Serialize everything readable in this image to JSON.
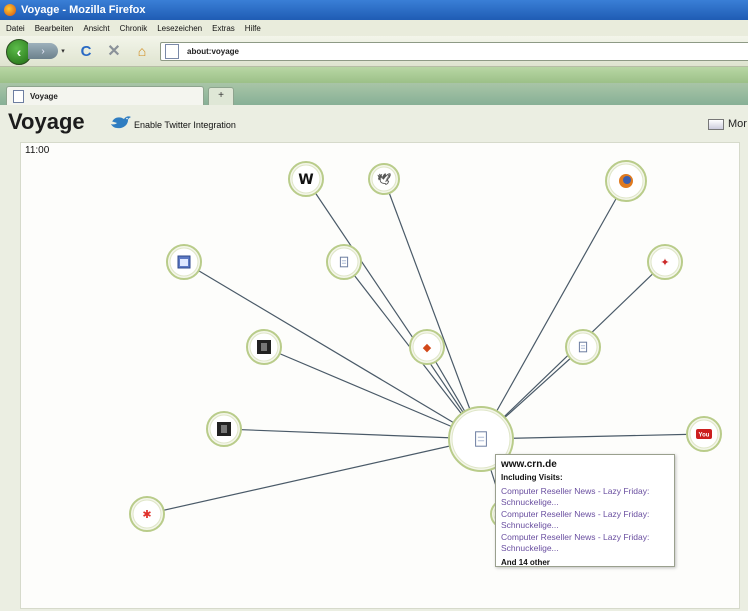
{
  "window": {
    "title": "Voyage - Mozilla Firefox"
  },
  "menu": {
    "items": [
      {
        "label": "Datei",
        "key": "D"
      },
      {
        "label": "Bearbeiten",
        "key": "B"
      },
      {
        "label": "Ansicht",
        "key": "A"
      },
      {
        "label": "Chronik",
        "key": "C"
      },
      {
        "label": "Lesezeichen",
        "key": "L"
      },
      {
        "label": "Extras",
        "key": "x"
      },
      {
        "label": "Hilfe",
        "key": "H"
      }
    ]
  },
  "toolbar": {
    "back_glyph": "‹",
    "forward_glyph": "›",
    "dropdown_glyph": "▾",
    "reload_glyph": "C",
    "stop_glyph": "✕",
    "home_glyph": "⌂"
  },
  "address": {
    "url": "about:voyage"
  },
  "tabs": {
    "active_label": "Voyage",
    "new_tab_glyph": "+"
  },
  "page": {
    "heading": "Voyage",
    "twitter_link": "Enable Twitter Integration",
    "more_label": "Mor",
    "time_label": "11:00"
  },
  "graph": {
    "center_icon": "document-icon",
    "nodes": [
      {
        "name": "wikipedia",
        "icon": "wikipedia-w-icon",
        "glyph": "W",
        "color": "#111111"
      },
      {
        "name": "bird-site",
        "icon": "bird-icon",
        "glyph": "🕊",
        "color": "#555555"
      },
      {
        "name": "firefox-site",
        "icon": "firefox-icon",
        "glyph": "◉",
        "color": "#d5651a"
      },
      {
        "name": "blue-site",
        "icon": "window-icon",
        "glyph": "▣",
        "color": "#4966b4"
      },
      {
        "name": "doc-top",
        "icon": "document-icon",
        "glyph": "",
        "color": "#6d7ea1"
      },
      {
        "name": "red-site-top-right",
        "icon": "red-logo-icon",
        "glyph": "✦",
        "color": "#cc2a2a"
      },
      {
        "name": "dark-site",
        "icon": "dark-square-icon",
        "glyph": "■",
        "color": "#222222"
      },
      {
        "name": "fox-site",
        "icon": "fox-icon",
        "glyph": "◆",
        "color": "#d2481a"
      },
      {
        "name": "doc-right",
        "icon": "document-icon",
        "glyph": "",
        "color": "#6d7ea1"
      },
      {
        "name": "dark-site-2",
        "icon": "dark-square-icon",
        "glyph": "◧",
        "color": "#222222"
      },
      {
        "name": "youtube",
        "icon": "youtube-icon",
        "glyph": "You",
        "color": "#cc1f1f"
      },
      {
        "name": "red-flower",
        "icon": "flower-icon",
        "glyph": "✱",
        "color": "#e0302a"
      },
      {
        "name": "hidden-under-tooltip",
        "icon": "document-icon",
        "glyph": "",
        "color": "#6d7ea1"
      }
    ]
  },
  "tooltip": {
    "domain": "www.crn.de",
    "subhead": "Including Visits:",
    "visits": [
      "Computer Reseller News - Lazy Friday: Schnuckelige...",
      "Computer Reseller News - Lazy Friday: Schnuckelige...",
      "Computer Reseller News - Lazy Friday: Schnuckelige..."
    ],
    "more": "And 14 other"
  },
  "colors": {
    "edge": "#4a5a68",
    "node_ring": "#b9cc8a",
    "node_fill": "#f4f6ea"
  }
}
